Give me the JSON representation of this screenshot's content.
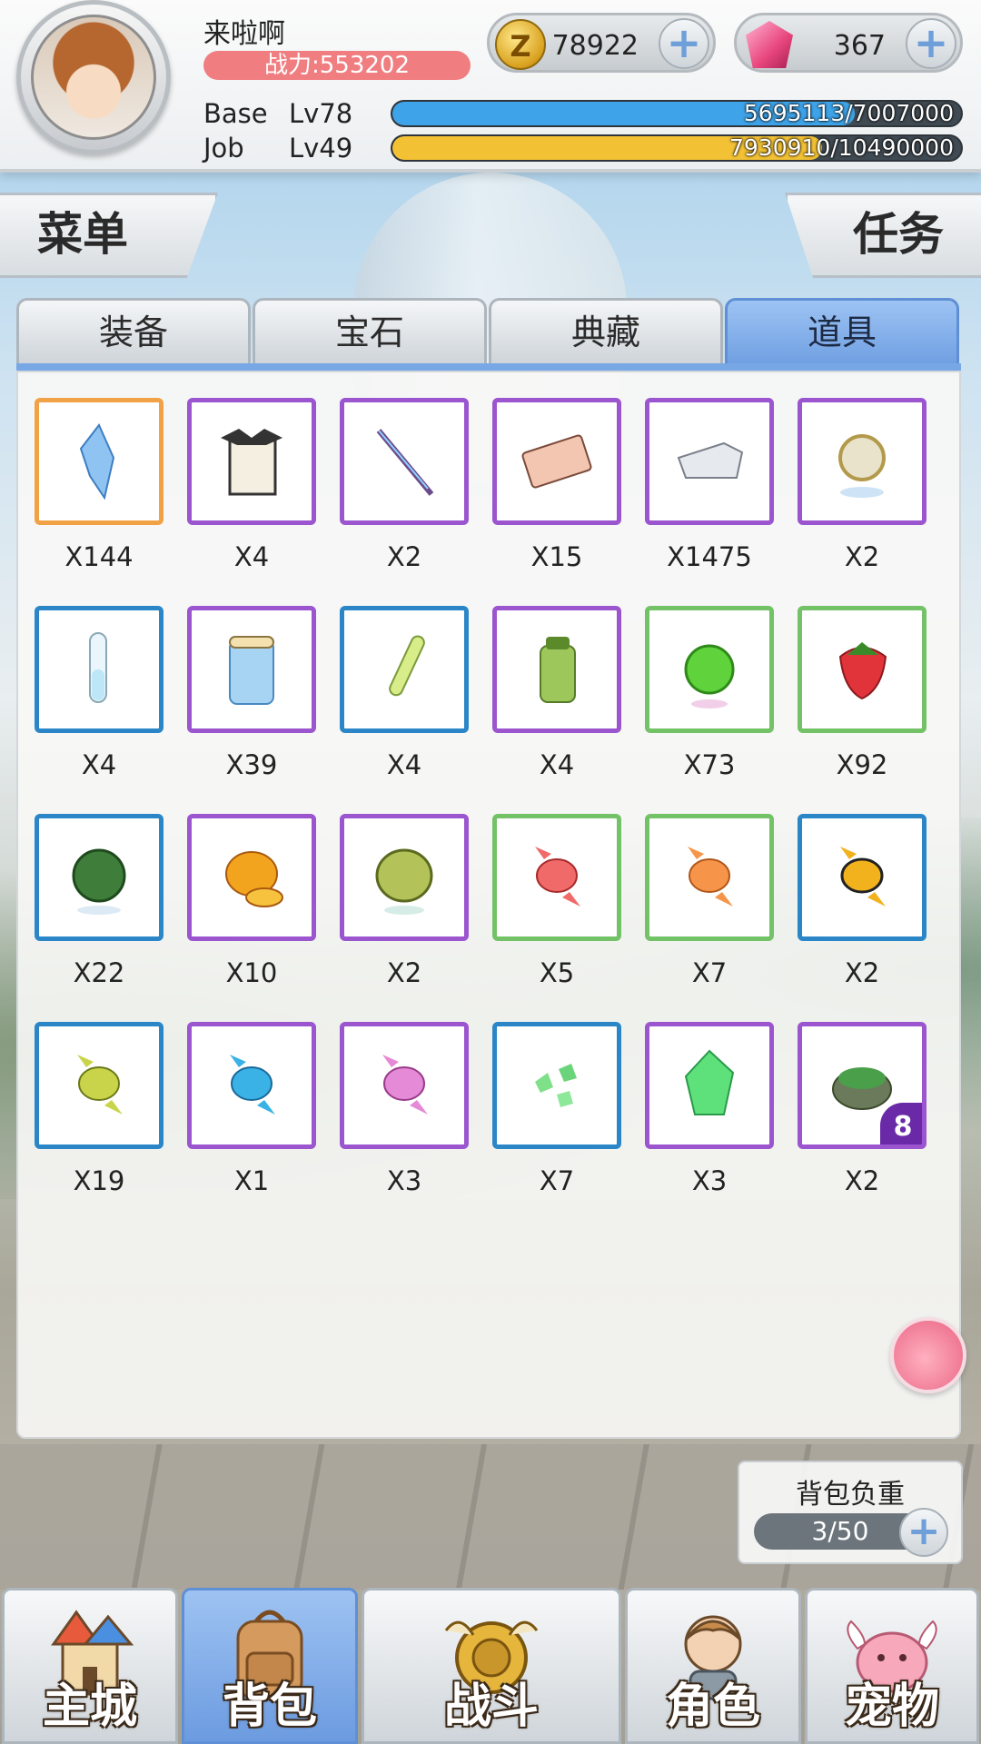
{
  "player": {
    "name": "来啦啊",
    "power": "战力:553202"
  },
  "currencies": {
    "zeny": {
      "icon": "zeny-coin-icon",
      "value": "78922"
    },
    "gem": {
      "icon": "pink-gem-icon",
      "value": "367"
    }
  },
  "levels": {
    "base": {
      "label": "Base",
      "level": "Lv78",
      "progress": "5695113/7007000",
      "fraction": 0.8128,
      "color": "#3ea3e8"
    },
    "job": {
      "label": "Job",
      "level": "Lv49",
      "progress": "7930910/10490000",
      "fraction": 0.756,
      "color": "#f2c134"
    }
  },
  "side_buttons": {
    "menu": "菜单",
    "quests": "任务"
  },
  "tabs": [
    {
      "label": "装备",
      "active": false
    },
    {
      "label": "宝石",
      "active": false
    },
    {
      "label": "典藏",
      "active": false
    },
    {
      "label": "道具",
      "active": true
    }
  ],
  "items": [
    {
      "icon": "blue-crystal-icon",
      "count": "X144",
      "quality": "orange"
    },
    {
      "icon": "bat-scroll-icon",
      "count": "X4",
      "quality": "purple"
    },
    {
      "icon": "magic-wand-icon",
      "count": "X2",
      "quality": "purple"
    },
    {
      "icon": "ticket-card-icon",
      "count": "X15",
      "quality": "purple"
    },
    {
      "icon": "steel-ingot-icon",
      "count": "X1475",
      "quality": "purple"
    },
    {
      "icon": "silver-coin-icon",
      "count": "X2",
      "quality": "purple"
    },
    {
      "icon": "test-tube-icon",
      "count": "X4",
      "quality": "blue"
    },
    {
      "icon": "water-jar-icon",
      "count": "X39",
      "quality": "purple"
    },
    {
      "icon": "green-potion-icon",
      "count": "X4",
      "quality": "blue"
    },
    {
      "icon": "green-bottle-icon",
      "count": "X4",
      "quality": "purple"
    },
    {
      "icon": "green-apple-icon",
      "count": "X73",
      "quality": "green"
    },
    {
      "icon": "strawberry-icon",
      "count": "X92",
      "quality": "green"
    },
    {
      "icon": "melon-icon",
      "count": "X22",
      "quality": "blue"
    },
    {
      "icon": "mango-icon",
      "count": "X10",
      "quality": "purple"
    },
    {
      "icon": "durian-icon",
      "count": "X2",
      "quality": "purple"
    },
    {
      "icon": "red-candy-icon",
      "count": "X5",
      "quality": "green"
    },
    {
      "icon": "orange-candy-icon",
      "count": "X7",
      "quality": "green"
    },
    {
      "icon": "bee-candy-icon",
      "count": "X2",
      "quality": "blue"
    },
    {
      "icon": "lime-candy-icon",
      "count": "X19",
      "quality": "blue"
    },
    {
      "icon": "blue-candy-icon",
      "count": "X1",
      "quality": "purple"
    },
    {
      "icon": "pink-candy-icon",
      "count": "X3",
      "quality": "purple"
    },
    {
      "icon": "green-shards-icon",
      "count": "X7",
      "quality": "blue"
    },
    {
      "icon": "green-crystal-icon",
      "count": "X3",
      "quality": "purple"
    },
    {
      "icon": "mossy-rock-icon",
      "count": "X2",
      "quality": "purple",
      "badge": "8"
    }
  ],
  "weight": {
    "title": "背包负重",
    "value": "3/50"
  },
  "nav": [
    {
      "label": "主城",
      "icon": "castle-icon",
      "active": false
    },
    {
      "label": "背包",
      "icon": "backpack-icon",
      "active": true
    },
    {
      "label": "战斗",
      "icon": "battle-shield-icon",
      "active": false
    },
    {
      "label": "角色",
      "icon": "character-icon",
      "active": false
    },
    {
      "label": "宠物",
      "icon": "poring-pet-icon",
      "active": false
    }
  ]
}
